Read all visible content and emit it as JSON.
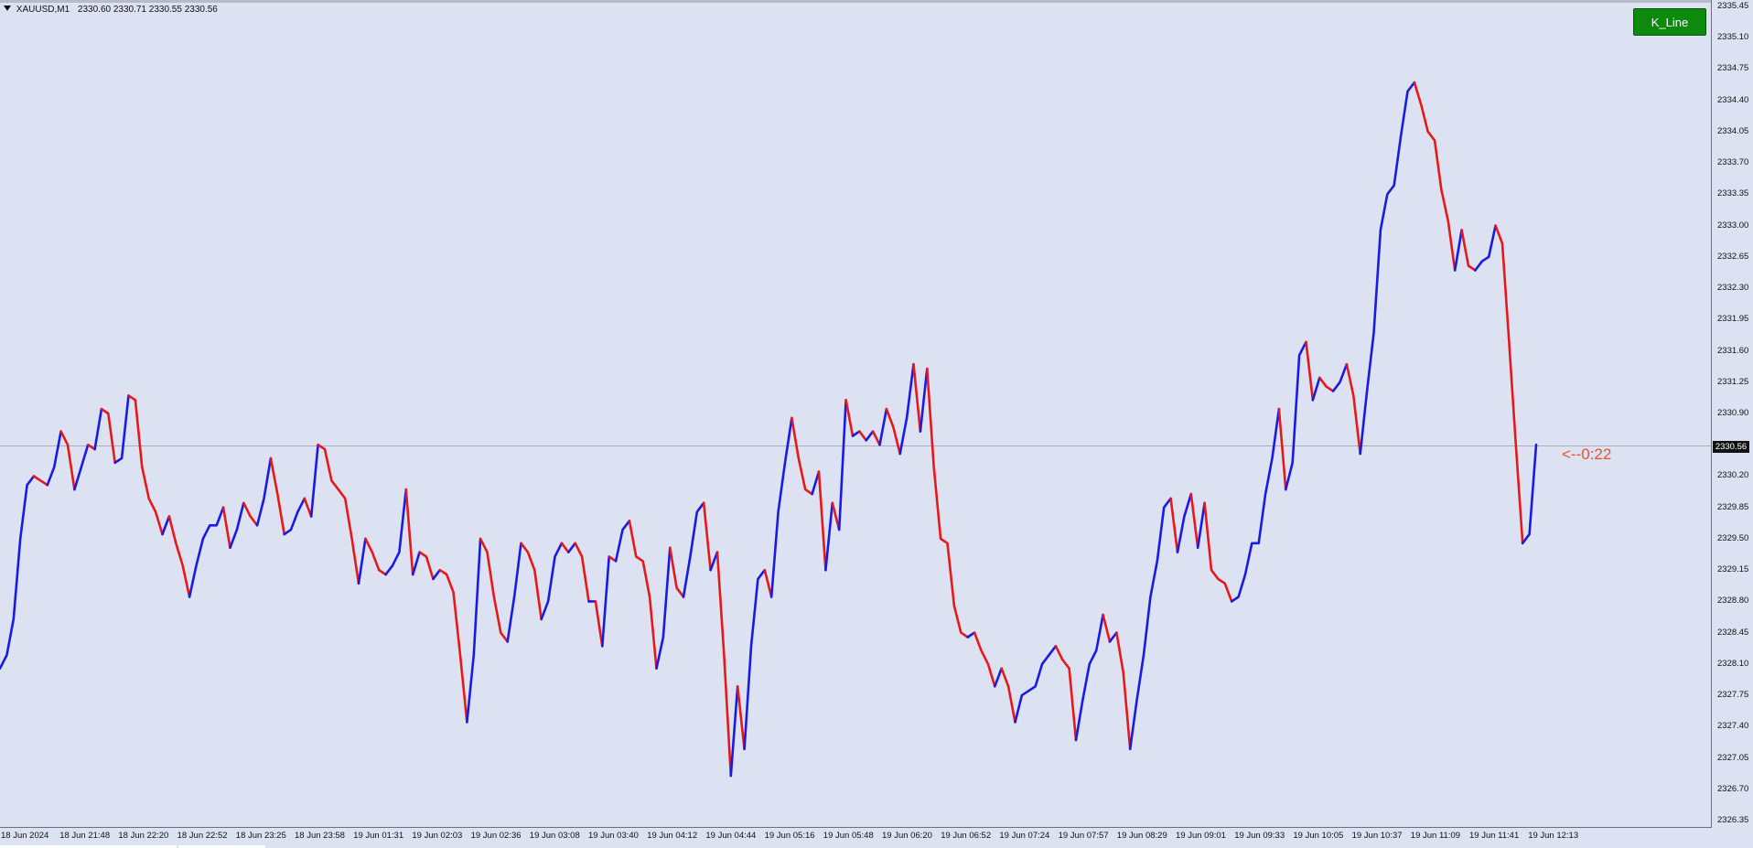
{
  "chart_info": {
    "symbol": "XAUUSD,M1",
    "ohlc": "2330.60 2330.71 2330.55 2330.56"
  },
  "button": {
    "label": "K_Line"
  },
  "countdown": "<--0:22",
  "current_price": "2330.56",
  "colors": {
    "up": "#1a1ae6",
    "down": "#e81818",
    "background": "#dde2f2",
    "button": "#0d8a0d",
    "countdown": "#e8522a"
  },
  "chart_data": {
    "type": "line",
    "title": "XAUUSD,M1",
    "xlabel": "",
    "ylabel": "",
    "ylim": [
      2326.2,
      2335.5
    ],
    "grid": false,
    "y_ticks": [
      "2335.45",
      "2335.10",
      "2334.75",
      "2334.40",
      "2334.05",
      "2333.70",
      "2333.35",
      "2333.00",
      "2332.65",
      "2332.30",
      "2331.95",
      "2331.60",
      "2331.25",
      "2330.90",
      "2330.56",
      "2330.20",
      "2329.85",
      "2329.50",
      "2329.15",
      "2328.80",
      "2328.45",
      "2328.10",
      "2327.75",
      "2327.40",
      "2327.05",
      "2326.70",
      "2326.35"
    ],
    "x_ticks": [
      "18 Jun 2024",
      "18 Jun 21:48",
      "18 Jun 22:20",
      "18 Jun 22:52",
      "18 Jun 23:25",
      "18 Jun 23:58",
      "19 Jun 01:31",
      "19 Jun 02:03",
      "19 Jun 02:36",
      "19 Jun 03:08",
      "19 Jun 03:40",
      "19 Jun 04:12",
      "19 Jun 04:44",
      "19 Jun 05:16",
      "19 Jun 05:48",
      "19 Jun 06:20",
      "19 Jun 06:52",
      "19 Jun 07:24",
      "19 Jun 07:57",
      "19 Jun 08:29",
      "19 Jun 09:01",
      "19 Jun 09:33",
      "19 Jun 10:05",
      "19 Jun 10:37",
      "19 Jun 11:09",
      "19 Jun 11:41",
      "19 Jun 12:13"
    ],
    "series": [
      {
        "values": [
          2328.05,
          2328.2,
          2328.6,
          2329.5,
          2330.1,
          2330.2,
          2330.15,
          2330.1,
          2330.3,
          2330.7,
          2330.55,
          2330.05,
          2330.3,
          2330.55,
          2330.5,
          2330.95,
          2330.9,
          2330.35,
          2330.4,
          2331.1,
          2331.05,
          2330.3,
          2329.95,
          2329.8,
          2329.55,
          2329.75,
          2329.45,
          2329.2,
          2328.85,
          2329.2,
          2329.5,
          2329.65,
          2329.65,
          2329.85,
          2329.4,
          2329.6,
          2329.9,
          2329.75,
          2329.65,
          2329.95,
          2330.4,
          2330.0,
          2329.55,
          2329.6,
          2329.8,
          2329.95,
          2329.75,
          2330.55,
          2330.5,
          2330.15,
          2330.05,
          2329.95,
          2329.5,
          2329.0,
          2329.5,
          2329.35,
          2329.15,
          2329.1,
          2329.2,
          2329.35,
          2330.05,
          2329.1,
          2329.35,
          2329.3,
          2329.05,
          2329.15,
          2329.1,
          2328.9,
          2328.2,
          2327.45,
          2328.2,
          2329.5,
          2329.35,
          2328.85,
          2328.45,
          2328.35,
          2328.85,
          2329.45,
          2329.35,
          2329.15,
          2328.6,
          2328.8,
          2329.3,
          2329.45,
          2329.35,
          2329.45,
          2329.3,
          2328.8,
          2328.8,
          2328.3,
          2329.3,
          2329.25,
          2329.6,
          2329.7,
          2329.3,
          2329.25,
          2328.85,
          2328.05,
          2328.4,
          2329.4,
          2328.95,
          2328.85,
          2329.3,
          2329.8,
          2329.9,
          2329.15,
          2329.35,
          2328.2,
          2326.85,
          2327.85,
          2327.15,
          2328.3,
          2329.05,
          2329.15,
          2328.85,
          2329.8,
          2330.35,
          2330.85,
          2330.4,
          2330.05,
          2330.0,
          2330.25,
          2329.15,
          2329.9,
          2329.6,
          2331.05,
          2330.65,
          2330.7,
          2330.6,
          2330.7,
          2330.55,
          2330.95,
          2330.75,
          2330.45,
          2330.85,
          2331.45,
          2330.7,
          2331.4,
          2330.3,
          2329.5,
          2329.45,
          2328.75,
          2328.45,
          2328.4,
          2328.45,
          2328.25,
          2328.1,
          2327.85,
          2328.05,
          2327.85,
          2327.45,
          2327.75,
          2327.8,
          2327.85,
          2328.1,
          2328.2,
          2328.3,
          2328.15,
          2328.05,
          2327.25,
          2327.7,
          2328.1,
          2328.25,
          2328.65,
          2328.35,
          2328.45,
          2328.0,
          2327.15,
          2327.7,
          2328.2,
          2328.85,
          2329.25,
          2329.85,
          2329.95,
          2329.35,
          2329.75,
          2330.0,
          2329.4,
          2329.9,
          2329.15,
          2329.05,
          2329.0,
          2328.8,
          2328.85,
          2329.1,
          2329.45,
          2329.45,
          2330.0,
          2330.4,
          2330.95,
          2330.05,
          2330.35,
          2331.55,
          2331.7,
          2331.05,
          2331.3,
          2331.2,
          2331.15,
          2331.25,
          2331.45,
          2331.1,
          2330.45,
          2331.15,
          2331.8,
          2332.95,
          2333.35,
          2333.45,
          2334.0,
          2334.5,
          2334.6,
          2334.35,
          2334.05,
          2333.95,
          2333.4,
          2333.05,
          2332.5,
          2332.95,
          2332.55,
          2332.5,
          2332.6,
          2332.65,
          2333.0,
          2332.8,
          2331.7,
          2330.55,
          2329.45,
          2329.55,
          2330.55
        ]
      }
    ]
  }
}
